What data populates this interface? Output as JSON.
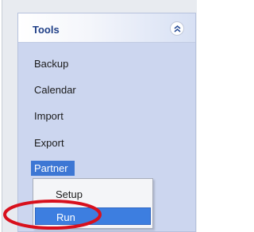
{
  "panel": {
    "title": "Tools",
    "items": [
      {
        "label": "Backup"
      },
      {
        "label": "Calendar"
      },
      {
        "label": "Import"
      },
      {
        "label": "Export"
      },
      {
        "label": "Partner",
        "active": true
      }
    ]
  },
  "context_menu": {
    "items": [
      {
        "label": "Setup"
      },
      {
        "label": "Run",
        "selected": true
      }
    ]
  },
  "annotation": {
    "color": "#d8101d"
  },
  "colors": {
    "header_text": "#1f3f87",
    "highlight": "#3d7ee0",
    "panel_bg": "#ccd6ef"
  }
}
